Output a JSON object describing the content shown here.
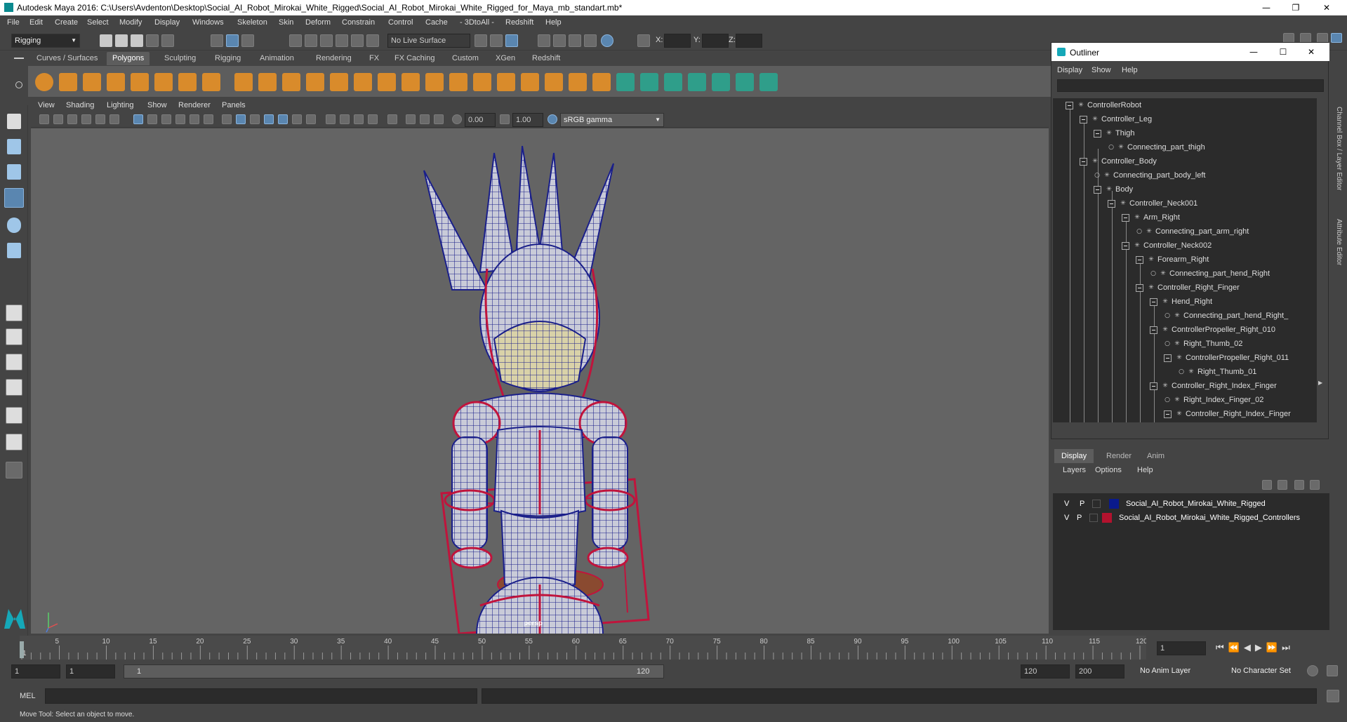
{
  "window": {
    "title": "Autodesk Maya 2016: C:\\Users\\Avdenton\\Desktop\\Social_AI_Robot_Mirokai_White_Rigged\\Social_AI_Robot_Mirokai_White_Rigged_for_Maya_mb_standart.mb*"
  },
  "menubar": [
    "File",
    "Edit",
    "Create",
    "Select",
    "Modify",
    "Display",
    "Windows",
    "Skeleton",
    "Skin",
    "Deform",
    "Constrain",
    "Control",
    "Cache",
    "- 3DtoAll -",
    "Redshift",
    "Help"
  ],
  "statusline": {
    "mode": "Rigging",
    "live_surface": "No Live Surface",
    "x_label": "X:",
    "y_label": "Y:",
    "z_label": "Z:"
  },
  "shelf_tabs": [
    "Curves / Surfaces",
    "Polygons",
    "Sculpting",
    "Rigging",
    "Animation",
    "Rendering",
    "FX",
    "FX Caching",
    "Custom",
    "XGen",
    "Redshift"
  ],
  "shelf_active": "Polygons",
  "viewport": {
    "menu": [
      "View",
      "Shading",
      "Lighting",
      "Show",
      "Renderer",
      "Panels"
    ],
    "exposure": "0.00",
    "gamma": "1.00",
    "color_space": "sRGB gamma",
    "camera_label": "persp"
  },
  "outliner": {
    "title": "Outliner",
    "menu": [
      "Display",
      "Show",
      "Help"
    ],
    "items": [
      {
        "label": "ControllerRobot",
        "depth": 0,
        "type": "group"
      },
      {
        "label": "Controller_Leg",
        "depth": 1,
        "type": "group"
      },
      {
        "label": "Thigh",
        "depth": 2,
        "type": "group"
      },
      {
        "label": "Connecting_part_thigh",
        "depth": 3,
        "type": "leaf"
      },
      {
        "label": "Controller_Body",
        "depth": 1,
        "type": "group"
      },
      {
        "label": "Connecting_part_body_left",
        "depth": 2,
        "type": "leaf"
      },
      {
        "label": "Body",
        "depth": 2,
        "type": "group"
      },
      {
        "label": "Controller_Neck001",
        "depth": 3,
        "type": "group"
      },
      {
        "label": "Arm_Right",
        "depth": 4,
        "type": "group"
      },
      {
        "label": "Connecting_part_arm_right",
        "depth": 5,
        "type": "leaf"
      },
      {
        "label": "Controller_Neck002",
        "depth": 4,
        "type": "group"
      },
      {
        "label": "Forearm_Right",
        "depth": 5,
        "type": "group"
      },
      {
        "label": "Connecting_part_hend_Right",
        "depth": 6,
        "type": "leaf"
      },
      {
        "label": "Controller_Right_Finger",
        "depth": 5,
        "type": "group"
      },
      {
        "label": "Hend_Right",
        "depth": 6,
        "type": "group"
      },
      {
        "label": "Connecting_part_hend_Right_",
        "depth": 7,
        "type": "leaf"
      },
      {
        "label": "ControllerPropeller_Right_010",
        "depth": 6,
        "type": "group"
      },
      {
        "label": "Right_Thumb_02",
        "depth": 7,
        "type": "leaf"
      },
      {
        "label": "ControllerPropeller_Right_011",
        "depth": 7,
        "type": "group"
      },
      {
        "label": "Right_Thumb_01",
        "depth": 8,
        "type": "leaf"
      },
      {
        "label": "Controller_Right_Index_Finger",
        "depth": 6,
        "type": "group"
      },
      {
        "label": "Right_Index_Finger_02",
        "depth": 7,
        "type": "leaf"
      },
      {
        "label": "Controller_Right_Index_Finger",
        "depth": 7,
        "type": "group"
      }
    ]
  },
  "layer_editor": {
    "tabs": [
      "Display",
      "Render",
      "Anim"
    ],
    "active_tab": "Display",
    "menu": [
      "Layers",
      "Options",
      "Help"
    ],
    "layers": [
      {
        "v": "V",
        "p": "P",
        "color": "#0a1a8c",
        "name": "Social_AI_Robot_Mirokai_White_Rigged"
      },
      {
        "v": "V",
        "p": "P",
        "color": "#b3122e",
        "name": "Social_AI_Robot_Mirokai_White_Rigged_Controllers"
      }
    ]
  },
  "side_tabs": [
    "Channel Box / Layer Editor",
    "Attribute Editor"
  ],
  "timeline": {
    "ticks": [
      "5",
      "10",
      "15",
      "20",
      "25",
      "30",
      "35",
      "40",
      "45",
      "50",
      "55",
      "60",
      "65",
      "70",
      "75",
      "80",
      "85",
      "90",
      "95",
      "100",
      "105",
      "110",
      "115",
      "120"
    ],
    "start_tick": "1",
    "current_frame": "1"
  },
  "range": {
    "start": "1",
    "playback_start": "1",
    "slider_start": "1",
    "slider_end": "120",
    "playback_end": "120",
    "end": "200",
    "anim_layer": "No Anim Layer",
    "character_set": "No Character Set"
  },
  "command_line": {
    "label": "MEL"
  },
  "help_line": "Move Tool: Select an object to move."
}
